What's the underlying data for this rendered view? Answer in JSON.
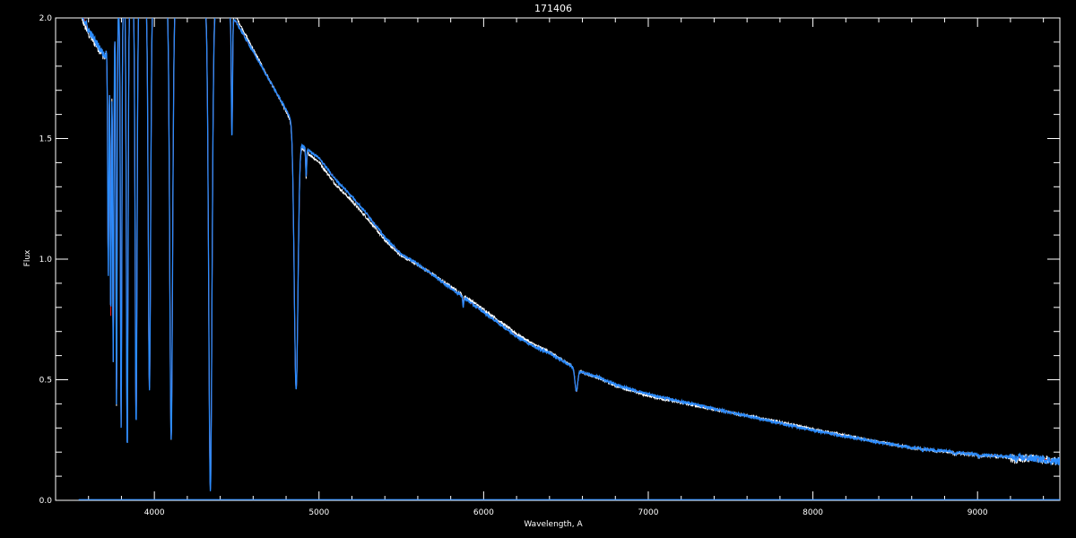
{
  "chart_data": {
    "type": "line",
    "title": "171406",
    "xlabel": "Wavelength, A",
    "ylabel": "Flux",
    "xlim": [
      3400,
      9500
    ],
    "ylim": [
      0.0,
      2.0
    ],
    "x_ticks": [
      4000,
      5000,
      6000,
      7000,
      8000,
      9000
    ],
    "y_ticks": [
      "0.0",
      "0.5",
      "1.0",
      "1.5",
      "2.0"
    ],
    "grid": false,
    "background": "#000000",
    "colors": {
      "axes": "#ffffff",
      "observed": "#ffffff",
      "model": "#d42020",
      "fit": "#2b8cff"
    },
    "continuum": [
      [
        3540,
        2.05
      ],
      [
        3600,
        1.95
      ],
      [
        3700,
        1.84
      ],
      [
        3800,
        2.05
      ],
      [
        4000,
        2.08
      ],
      [
        4200,
        2.06
      ],
      [
        4400,
        2.04
      ],
      [
        4500,
        1.98
      ],
      [
        4600,
        1.86
      ],
      [
        4700,
        1.74
      ],
      [
        4800,
        1.62
      ],
      [
        4850,
        1.55
      ],
      [
        4900,
        1.47
      ],
      [
        5000,
        1.42
      ],
      [
        5100,
        1.33
      ],
      [
        5200,
        1.26
      ],
      [
        5300,
        1.18
      ],
      [
        5400,
        1.09
      ],
      [
        5500,
        1.02
      ],
      [
        5600,
        0.98
      ],
      [
        5700,
        0.93
      ],
      [
        5800,
        0.88
      ],
      [
        5900,
        0.83
      ],
      [
        6000,
        0.78
      ],
      [
        6100,
        0.73
      ],
      [
        6200,
        0.68
      ],
      [
        6300,
        0.64
      ],
      [
        6400,
        0.61
      ],
      [
        6500,
        0.57
      ],
      [
        6600,
        0.53
      ],
      [
        6700,
        0.51
      ],
      [
        6800,
        0.48
      ],
      [
        6900,
        0.46
      ],
      [
        7000,
        0.44
      ],
      [
        7200,
        0.41
      ],
      [
        7400,
        0.38
      ],
      [
        7600,
        0.35
      ],
      [
        7800,
        0.32
      ],
      [
        8000,
        0.29
      ],
      [
        8200,
        0.265
      ],
      [
        8400,
        0.24
      ],
      [
        8600,
        0.22
      ],
      [
        8800,
        0.205
      ],
      [
        9000,
        0.19
      ],
      [
        9200,
        0.18
      ],
      [
        9400,
        0.17
      ],
      [
        9500,
        0.16
      ]
    ],
    "absorption_lines": [
      {
        "center": 3720,
        "depth": 0.5,
        "width": 5
      },
      {
        "center": 3735,
        "depth": 0.6,
        "width": 5
      },
      {
        "center": 3750,
        "depth": 0.7,
        "width": 5
      },
      {
        "center": 3770,
        "depth": 0.8,
        "width": 5
      },
      {
        "center": 3798,
        "depth": 0.85,
        "width": 6
      },
      {
        "center": 3835,
        "depth": 0.9,
        "width": 7
      },
      {
        "center": 3889,
        "depth": 0.85,
        "width": 8
      },
      {
        "center": 3970,
        "depth": 0.78,
        "width": 10
      },
      {
        "center": 4102,
        "depth": 0.88,
        "width": 12
      },
      {
        "center": 4340,
        "depth": 0.98,
        "width": 14
      },
      {
        "center": 4471,
        "depth": 0.25,
        "width": 5
      },
      {
        "center": 4861,
        "depth": 0.7,
        "width": 16
      },
      {
        "center": 4922,
        "depth": 0.08,
        "width": 4
      },
      {
        "center": 5876,
        "depth": 0.05,
        "width": 4
      },
      {
        "center": 6563,
        "depth": 0.17,
        "width": 12
      },
      {
        "center": 8598,
        "depth": 0.02,
        "width": 10
      },
      {
        "center": 8665,
        "depth": 0.03,
        "width": 10
      },
      {
        "center": 8750,
        "depth": 0.03,
        "width": 11
      },
      {
        "center": 8863,
        "depth": 0.035,
        "width": 12
      },
      {
        "center": 9015,
        "depth": 0.04,
        "width": 13
      },
      {
        "center": 9229,
        "depth": 0.045,
        "width": 14
      }
    ],
    "zero_level": 0.0
  }
}
